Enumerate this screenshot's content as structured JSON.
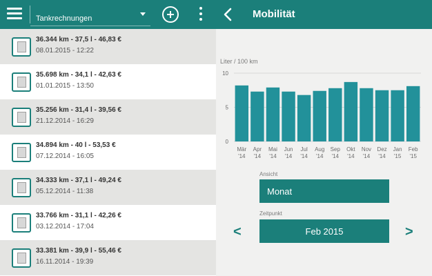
{
  "app": {
    "category_select": {
      "selected": "Tankrechnungen"
    },
    "screen_title": "Mobilität",
    "accent_color": "#1b7f7a",
    "icons": {
      "menu": "hamburger-menu-icon",
      "add": "add-circle-icon",
      "overflow": "more-vertical-icon",
      "back": "chevron-left-icon",
      "row": "receipt-document-icon"
    }
  },
  "receipts": [
    {
      "summary": "36.344 km - 37,5 l - 46,83 €",
      "date": "08.01.2015 - 12:22"
    },
    {
      "summary": "35.698 km - 34,1 l - 42,63 €",
      "date": "01.01.2015 - 13:50"
    },
    {
      "summary": "35.256 km - 31,4 l - 39,56 €",
      "date": "21.12.2014 - 16:29"
    },
    {
      "summary": "34.894 km - 40 l - 53,53 €",
      "date": "07.12.2014 - 16:05"
    },
    {
      "summary": "34.333 km - 37,1 l - 49,24 €",
      "date": "05.12.2014 - 11:38"
    },
    {
      "summary": "33.766 km - 31,1 l - 42,26 €",
      "date": "03.12.2014 - 17:04"
    },
    {
      "summary": "33.381 km - 39,9 l - 55,46 €",
      "date": "16.11.2014 - 19:39"
    }
  ],
  "chart_data": {
    "type": "bar",
    "ylabel": "Liter / 100 km",
    "ylim": [
      0,
      10
    ],
    "yticks": [
      "0",
      "5",
      "10"
    ],
    "grid": true,
    "categories": [
      "Mär '14",
      "Apr '14",
      "Mai '14",
      "Jun '14",
      "Jul '14",
      "Aug '14",
      "Sep '14",
      "Okt '14",
      "Nov '14",
      "Dez '14",
      "Jan '15",
      "Feb '15"
    ],
    "category_lines": [
      [
        "Mär",
        "'14"
      ],
      [
        "Apr",
        "'14"
      ],
      [
        "Mai",
        "'14"
      ],
      [
        "Jun",
        "'14"
      ],
      [
        "Jul",
        "'14"
      ],
      [
        "Aug",
        "'14"
      ],
      [
        "Sep",
        "'14"
      ],
      [
        "Okt",
        "'14"
      ],
      [
        "Nov",
        "'14"
      ],
      [
        "Dez",
        "'14"
      ],
      [
        "Jan",
        "'15"
      ],
      [
        "Feb",
        "'15"
      ]
    ],
    "values": [
      8.2,
      7.3,
      7.9,
      7.3,
      6.8,
      7.4,
      7.8,
      8.7,
      7.8,
      7.5,
      7.5,
      8.1
    ],
    "bar_color": "#22919a"
  },
  "view_select": {
    "label": "Ansicht",
    "value": "Monat"
  },
  "period_select": {
    "label": "Zeitpunkt",
    "value": "Feb 2015",
    "prev": "<",
    "next": ">"
  }
}
